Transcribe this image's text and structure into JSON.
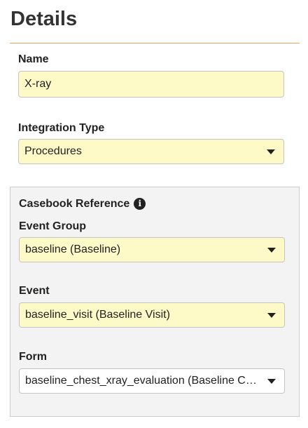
{
  "page": {
    "title": "Details"
  },
  "name_field": {
    "label": "Name",
    "value": "X-ray"
  },
  "integration_type": {
    "label": "Integration Type",
    "selected": "Procedures"
  },
  "casebook": {
    "heading": "Casebook Reference",
    "info_icon": "info-icon",
    "event_group": {
      "label": "Event Group",
      "selected": "baseline (Baseline)"
    },
    "event": {
      "label": "Event",
      "selected": "baseline_visit (Baseline Visit)"
    },
    "form": {
      "label": "Form",
      "selected": "baseline_chest_xray_evaluation (Baseline Chest X-ray Evaluation)"
    }
  },
  "colors": {
    "field_highlight": "#fefac8",
    "accent_divider": "#f0a35e",
    "panel_background": "#f3f3f3"
  }
}
